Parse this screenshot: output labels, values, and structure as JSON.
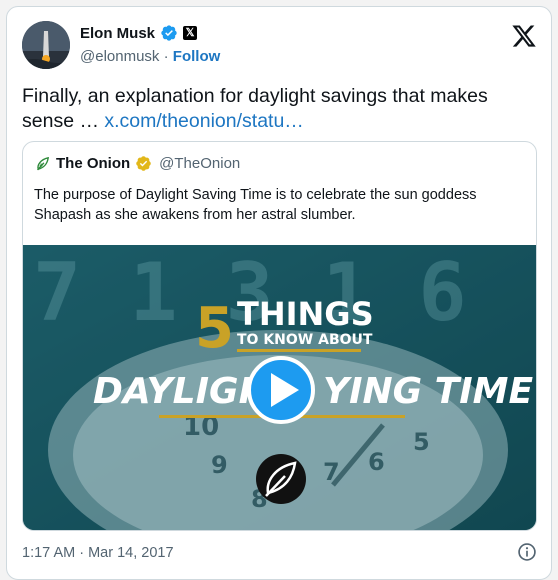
{
  "author": {
    "name": "Elon Musk",
    "handle": "@elonmusk",
    "separator": "·",
    "follow_label": "Follow",
    "x_badge": "𝕏"
  },
  "tweet": {
    "text": "Finally, an explanation for daylight savings that makes sense …",
    "link_text": "x.com/theonion/statu…"
  },
  "quote": {
    "name": "The Onion",
    "handle": "@TheOnion",
    "text": "The purpose of Daylight Saving Time is to celebrate the sun goddess Shapash as she awakens from her astral slumber.",
    "media": {
      "big_number": "5",
      "headline_1": "THINGS",
      "headline_2": "TO KNOW ABOUT",
      "headline_3a": "DAYLIGHT",
      "headline_3b": "YING TIME",
      "clock_digits": "7 1 3 1 6"
    }
  },
  "footer": {
    "timestamp": "1:17 AM · Mar 14, 2017"
  },
  "colors": {
    "verified_blue": "#1d9bf0",
    "verified_gold": "#e2b719",
    "link": "#1d76c2",
    "gold_text": "#c9a227",
    "play_button": "#1d9bf0"
  },
  "icons": [
    "verified-badge-icon",
    "gold-verified-badge-icon",
    "x-logo-icon",
    "onion-logo-icon",
    "play-icon",
    "info-icon"
  ]
}
